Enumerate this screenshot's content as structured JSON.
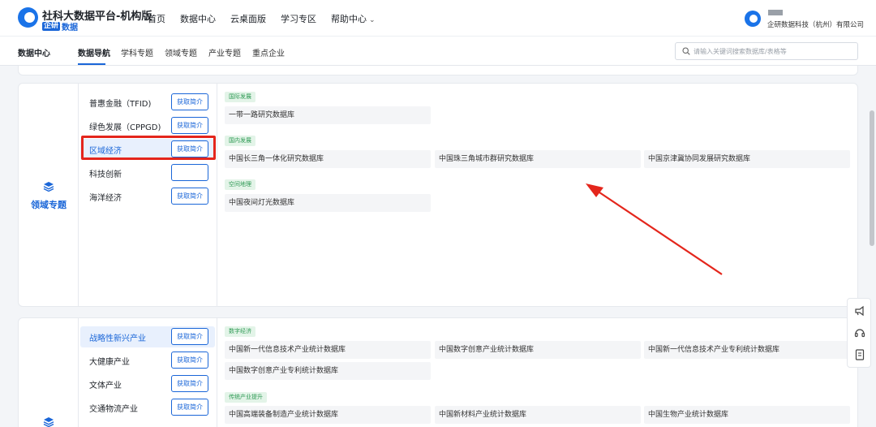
{
  "header": {
    "brand_title": "社科大数据平台-机构版",
    "brand_badge": "企研",
    "brand_sub": "数据",
    "nav": [
      {
        "label": "首页"
      },
      {
        "label": "数据中心"
      },
      {
        "label": "云桌面版"
      },
      {
        "label": "学习专区"
      },
      {
        "label": "帮助中心"
      }
    ],
    "user_org": "企研数据科技（杭州）有限公司"
  },
  "subnav": {
    "items": [
      {
        "label": "数据中心"
      },
      {
        "label": "数据导航"
      },
      {
        "label": "学科专题"
      },
      {
        "label": "领域专题"
      },
      {
        "label": "产业专题"
      },
      {
        "label": "重点企业"
      }
    ],
    "active": "数据导航",
    "search_placeholder": "请输入关键词搜索数据库/表格等"
  },
  "domain_card": {
    "title": "领域专题",
    "icon": "layers-icon",
    "categories": [
      {
        "label": "普惠金融（TFID)",
        "button": "获取简介"
      },
      {
        "label": "绿色发展（CPPGD)",
        "button": "获取简介"
      },
      {
        "label": "区域经济",
        "button": "获取简介",
        "active": true
      },
      {
        "label": "科技创新"
      },
      {
        "label": "海洋经济",
        "button": "获取简介"
      }
    ],
    "groups": [
      {
        "tag": "国际发展",
        "items": [
          "一带一路研究数据库"
        ]
      },
      {
        "tag": "国内发展",
        "items": [
          "中国长三角一体化研究数据库",
          "中国珠三角城市群研究数据库",
          "中国京津冀协同发展研究数据库"
        ]
      },
      {
        "tag": "空间地理",
        "items": [
          "中国夜间灯光数据库"
        ]
      }
    ]
  },
  "industry_card": {
    "icon": "layers-icon",
    "categories": [
      {
        "label": "战略性新兴产业",
        "button": "获取简介",
        "active": true
      },
      {
        "label": "大健康产业",
        "button": "获取简介"
      },
      {
        "label": "文体产业",
        "button": "获取简介"
      },
      {
        "label": "交通物流产业",
        "button": "获取简介"
      }
    ],
    "groups": [
      {
        "tag": "数字经济",
        "items": [
          "中国新一代信息技术产业统计数据库",
          "中国数字创意产业统计数据库",
          "中国新一代信息技术产业专利统计数据库",
          "中国数字创意产业专利统计数据库"
        ]
      },
      {
        "tag": "传统产业提升",
        "items": [
          "中国高端装备制造产业统计数据库",
          "中国新材料产业统计数据库",
          "中国生物产业统计数据库"
        ]
      }
    ]
  },
  "float_tools": [
    "megaphone-icon",
    "headset-icon",
    "document-icon"
  ],
  "colors": {
    "accent": "#1a66d8",
    "highlight": "#e4261c",
    "tag_green": "#2f9a55"
  }
}
